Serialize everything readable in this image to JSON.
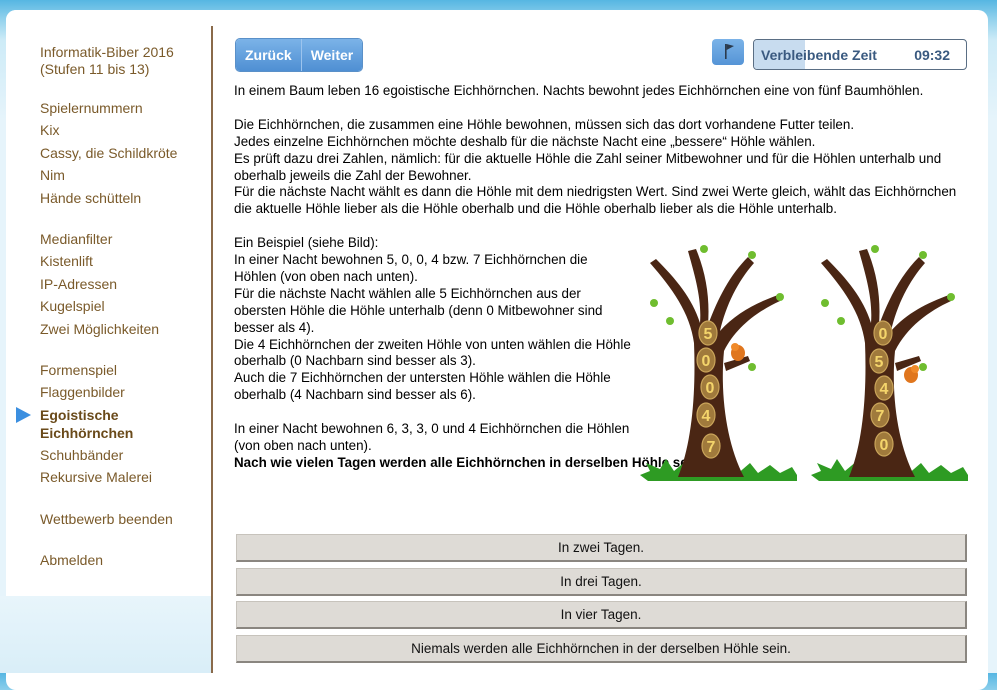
{
  "sidebar": {
    "title": "Informatik-Biber 2016 (Stufen 11 bis 13)",
    "groups": [
      [
        "Spielernummern",
        "Kix",
        "Cassy, die Schildkröte",
        "Nim",
        "Hände schütteln"
      ],
      [
        "Medianfilter",
        "Kistenlift",
        "IP-Adressen",
        "Kugelspiel",
        "Zwei Möglichkeiten"
      ],
      [
        "Formenspiel",
        "Flaggenbilder",
        "Egoistische Eichhörnchen",
        "Schuhbänder",
        "Rekursive Malerei"
      ],
      [
        "Wettbewerb beenden"
      ],
      [
        "Abmelden"
      ]
    ],
    "active_item": "Egoistische Eichhörnchen"
  },
  "toolbar": {
    "back_label": "Zurück",
    "next_label": "Weiter",
    "timer_label": "Verbleibende Zeit",
    "timer_value": "09:32",
    "timer_progress": 0.24
  },
  "task": {
    "intro": "In einem Baum leben 16 egoistische Eichhörnchen. Nachts bewohnt jedes Eichhörnchen eine von fünf Baumhöhlen.",
    "p1": "Die Eichhörnchen, die zusammen eine Höhle bewohnen, müssen sich das dort vorhandene Futter teilen.",
    "p2": "Jedes einzelne Eichhörnchen möchte deshalb für die nächste Nacht eine „bessere“ Höhle wählen.",
    "p3": "Es prüft dazu drei Zahlen, nämlich: für die aktuelle Höhle die Zahl seiner Mitbewohner und für die Höhlen unterhalb und oberhalb jeweils die Zahl der Bewohner.",
    "p4": "Für die nächste Nacht wählt es dann die Höhle mit dem niedrigsten Wert. Sind zwei Werte gleich, wählt das Eichhörnchen die aktuelle Höhle lieber als die Höhle oberhalb und die Höhle oberhalb lieber als die Höhle unterhalb.",
    "ex_title": "Ein Beispiel (siehe Bild):",
    "ex1": "In einer Nacht bewohnen 5, 0, 0, 4 bzw. 7 Eichhörnchen die Höhlen (von oben nach unten).",
    "ex2": "Für die nächste Nacht wählen alle 5 Eichhörnchen aus der obersten Höhle die Höhle unterhalb (denn 0 Mitbewohner sind besser als 4).",
    "ex3": "Die 4 Eichhörnchen der zweiten Höhle von unten wählen die Höhle oberhalb (0 Nachbarn sind besser als 3).",
    "ex4": "Auch die 7 Eichhörnchen der untersten Höhle wählen die Höhle oberhalb (4 Nachbarn sind besser als 6).",
    "scenario": "In einer Nacht bewohnen 6, 3, 3, 0 und 4 Eichhörnchen die Höhlen (von oben nach unten).",
    "question": "Nach wie vielen Tagen werden alle Eichhörnchen in derselben Höhle sein?",
    "tree_left": [
      "5",
      "0",
      "0",
      "4",
      "7"
    ],
    "tree_right": [
      "0",
      "5",
      "4",
      "7",
      "0"
    ]
  },
  "answers": [
    "In zwei Tagen.",
    "In drei Tagen.",
    "In vier Tagen.",
    "Niemals werden alle Eichhörnchen in der derselben Höhle sein."
  ]
}
